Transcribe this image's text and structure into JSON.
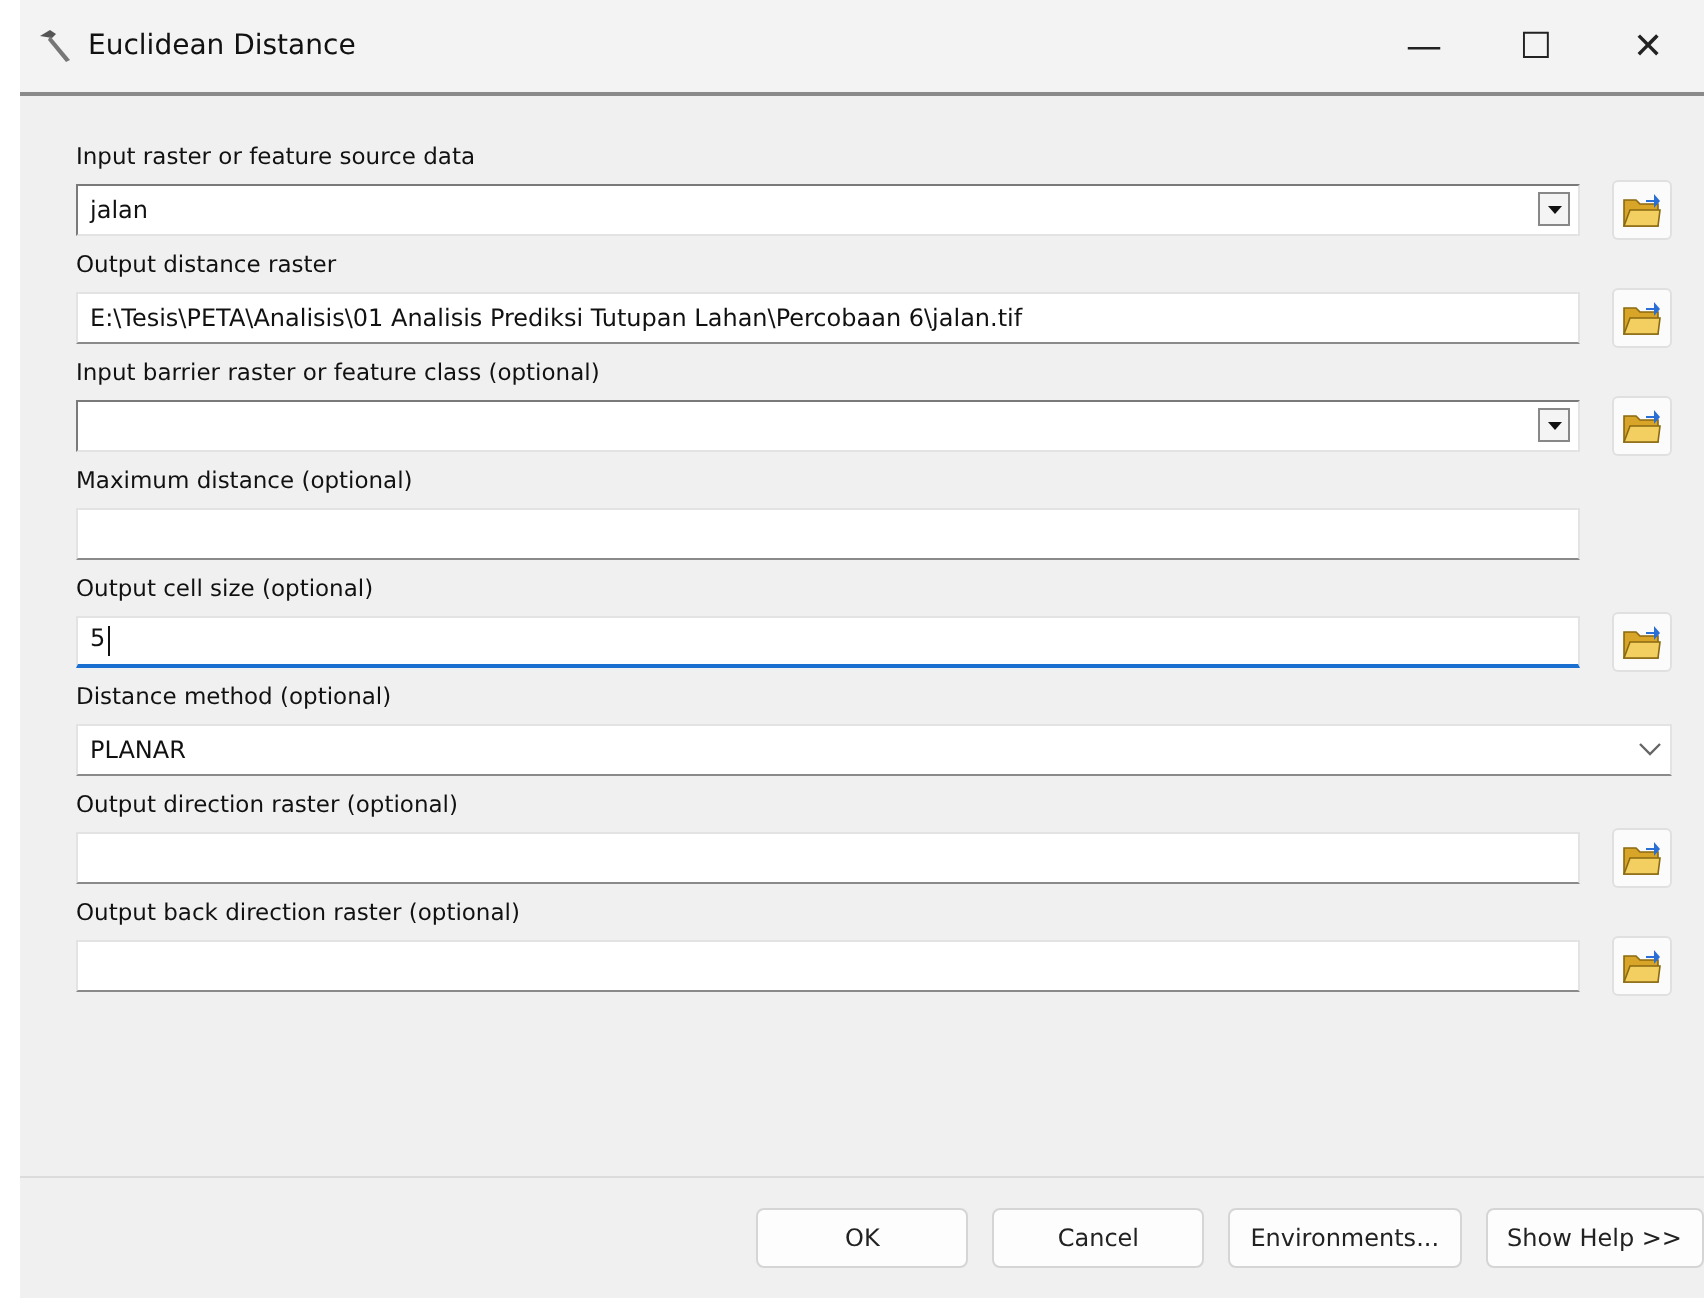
{
  "window": {
    "title": "Euclidean Distance",
    "controls": [
      "—",
      "☐",
      "✕"
    ]
  },
  "fields": [
    {
      "label": "Input raster or feature source data",
      "kind": "combo",
      "value": "jalan",
      "browse": true,
      "focused": false
    },
    {
      "label": "Output distance raster",
      "kind": "text",
      "value": "E:\\Tesis\\PETA\\Analisis\\01 Analisis Prediksi Tutupan Lahan\\Percobaan 6\\jalan.tif",
      "browse": true,
      "focused": false
    },
    {
      "label": "Input barrier raster or feature class (optional)",
      "kind": "combo",
      "browse": true,
      "focused": false
    },
    {
      "label": "Maximum distance (optional)",
      "kind": "text",
      "browse": false,
      "focused": false
    },
    {
      "label": "Output cell size (optional)",
      "kind": "text",
      "value": "5",
      "browse": true,
      "focused": true
    },
    {
      "label": "Distance method (optional)",
      "kind": "select",
      "value": "PLANAR",
      "browse": false,
      "focused": false
    },
    {
      "label": "Output direction raster (optional)",
      "kind": "text",
      "browse": true,
      "focused": false
    },
    {
      "label": "Output back direction raster (optional)",
      "kind": "text",
      "browse": true,
      "focused": false
    }
  ],
  "buttons": [
    "OK",
    "Cancel",
    "Environments...",
    "Show Help >>"
  ]
}
